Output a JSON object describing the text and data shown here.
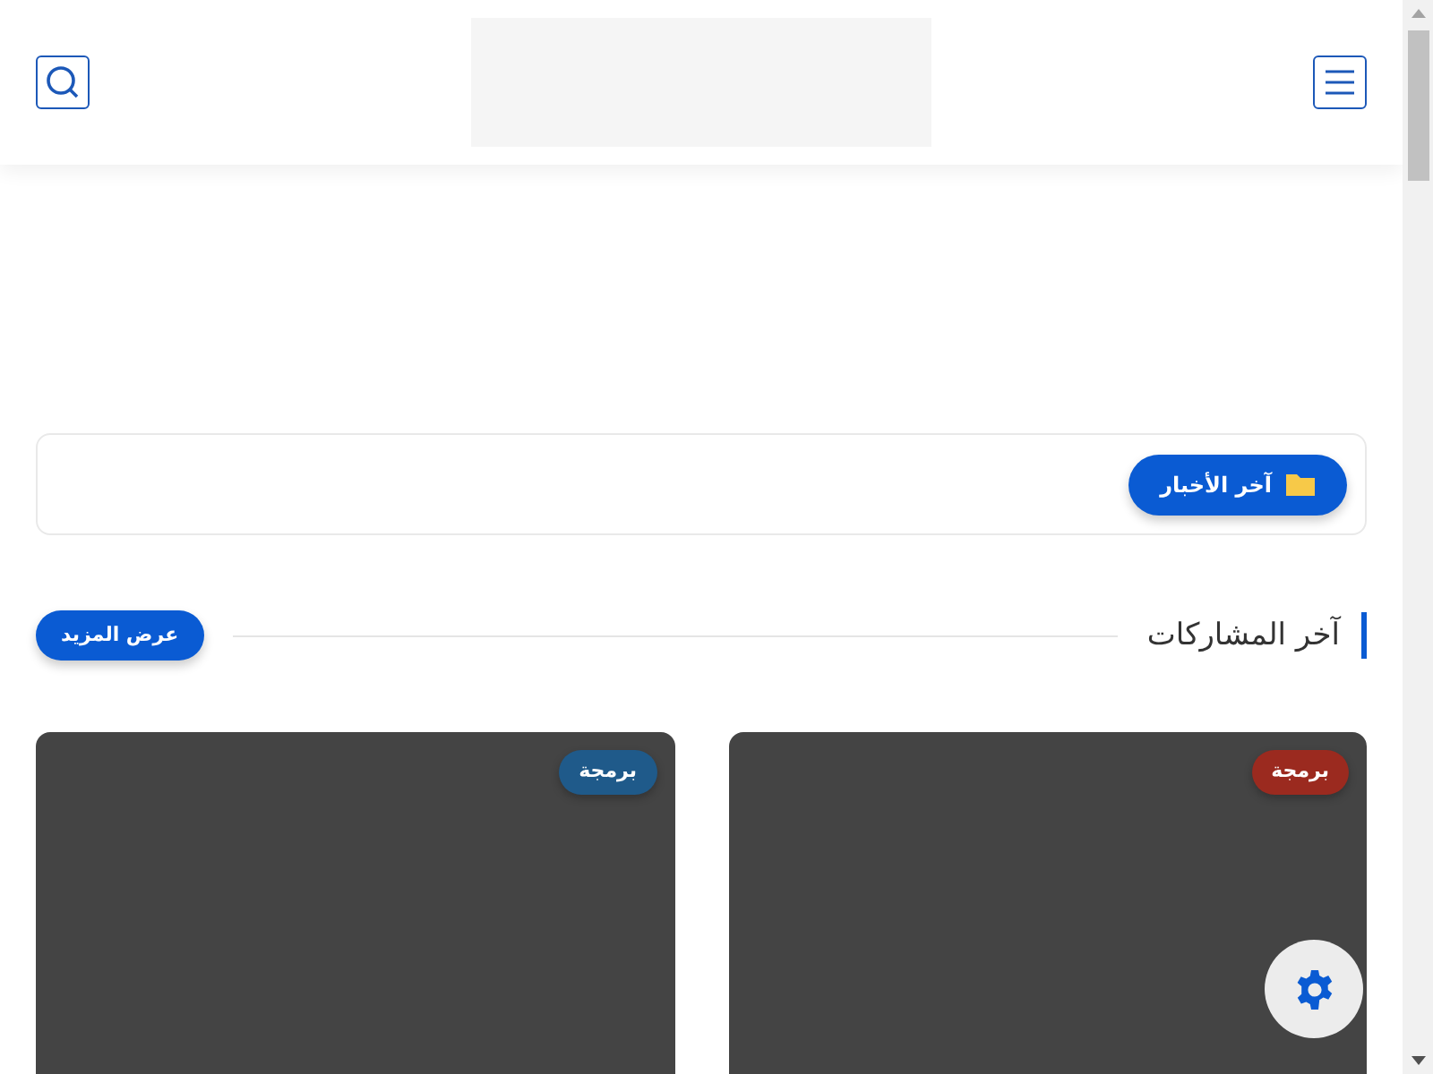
{
  "ticker": {
    "label": "آخر الأخبار"
  },
  "section": {
    "title": "آخر المشاركات",
    "more_button": "عرض المزيد"
  },
  "posts": [
    {
      "category": "برمجة",
      "color": "#9b2a1f"
    },
    {
      "category": "برمجة",
      "color": "#1f5a8a"
    }
  ]
}
